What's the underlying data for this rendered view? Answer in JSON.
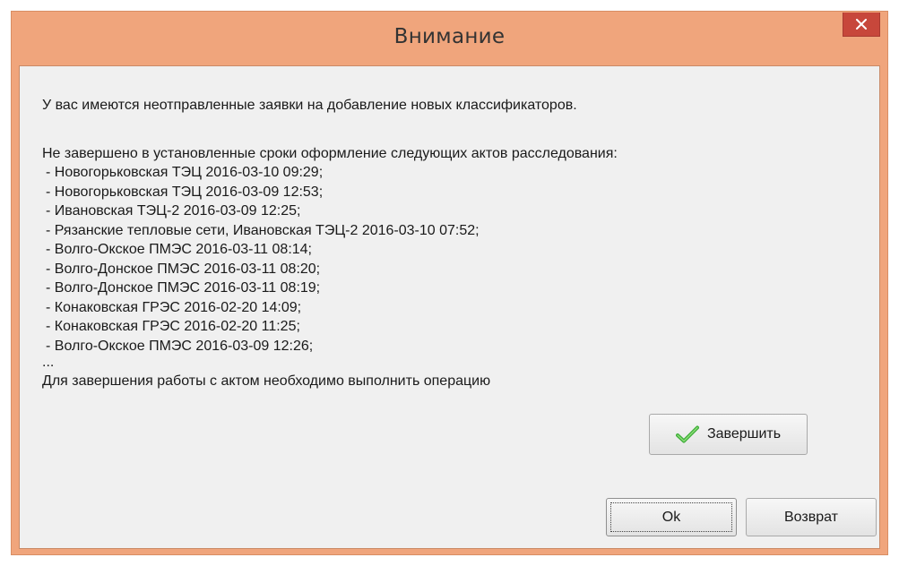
{
  "window": {
    "title": "Внимание",
    "colors": {
      "frame": "#f0a57c",
      "close": "#c7473b",
      "client": "#f0f0f0"
    }
  },
  "close_button": {
    "icon": "close-icon"
  },
  "message": {
    "notice": "У вас имеются неотправленные заявки на добавление новых классификаторов.",
    "acts_header": "Не завершено в установленные сроки оформление следующих актов расследования:",
    "acts": [
      "- Новогорьковская ТЭЦ 2016-03-10 09:29;",
      "- Новогорьковская ТЭЦ 2016-03-09 12:53;",
      "- Ивановская ТЭЦ-2 2016-03-09 12:25;",
      "- Рязанские тепловые сети, Ивановская ТЭЦ-2 2016-03-10 07:52;",
      "- Волго-Окское ПМЭС 2016-03-11 08:14;",
      "- Волго-Донское ПМЭС 2016-03-11 08:20;",
      "- Волго-Донское ПМЭС 2016-03-11 08:19;",
      "- Конаковская ГРЭС 2016-02-20 14:09;",
      "- Конаковская ГРЭС 2016-02-20 11:25;",
      "- Волго-Окское ПМЭС 2016-03-09 12:26;"
    ],
    "ellipsis": "...",
    "finish_text": "Для завершения работы с актом необходимо выполнить операцию"
  },
  "buttons": {
    "finish": {
      "label": "Завершить",
      "icon": "checkmark-icon"
    },
    "ok": "Ok",
    "back": "Возврат"
  }
}
